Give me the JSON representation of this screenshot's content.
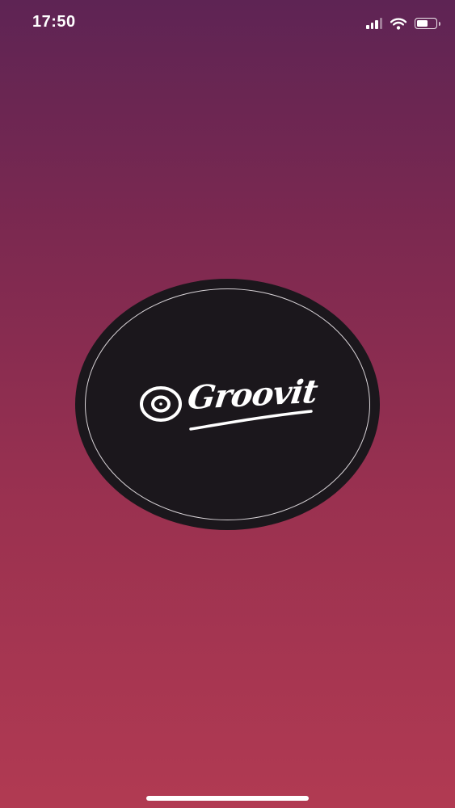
{
  "status_bar": {
    "time": "17:50",
    "signal_icon": "cellular-signal-icon",
    "wifi_icon": "wifi-icon",
    "battery_icon": "battery-icon",
    "battery_level": 0.6
  },
  "splash": {
    "brand_name": "Groovit",
    "logo_icon": "vinyl-record-icon"
  },
  "colors": {
    "gradient_top": "#5e2454",
    "gradient_bottom": "#b13a52",
    "disc": "#1b171c",
    "ring": "#d9d4d8",
    "foreground": "#ffffff"
  }
}
